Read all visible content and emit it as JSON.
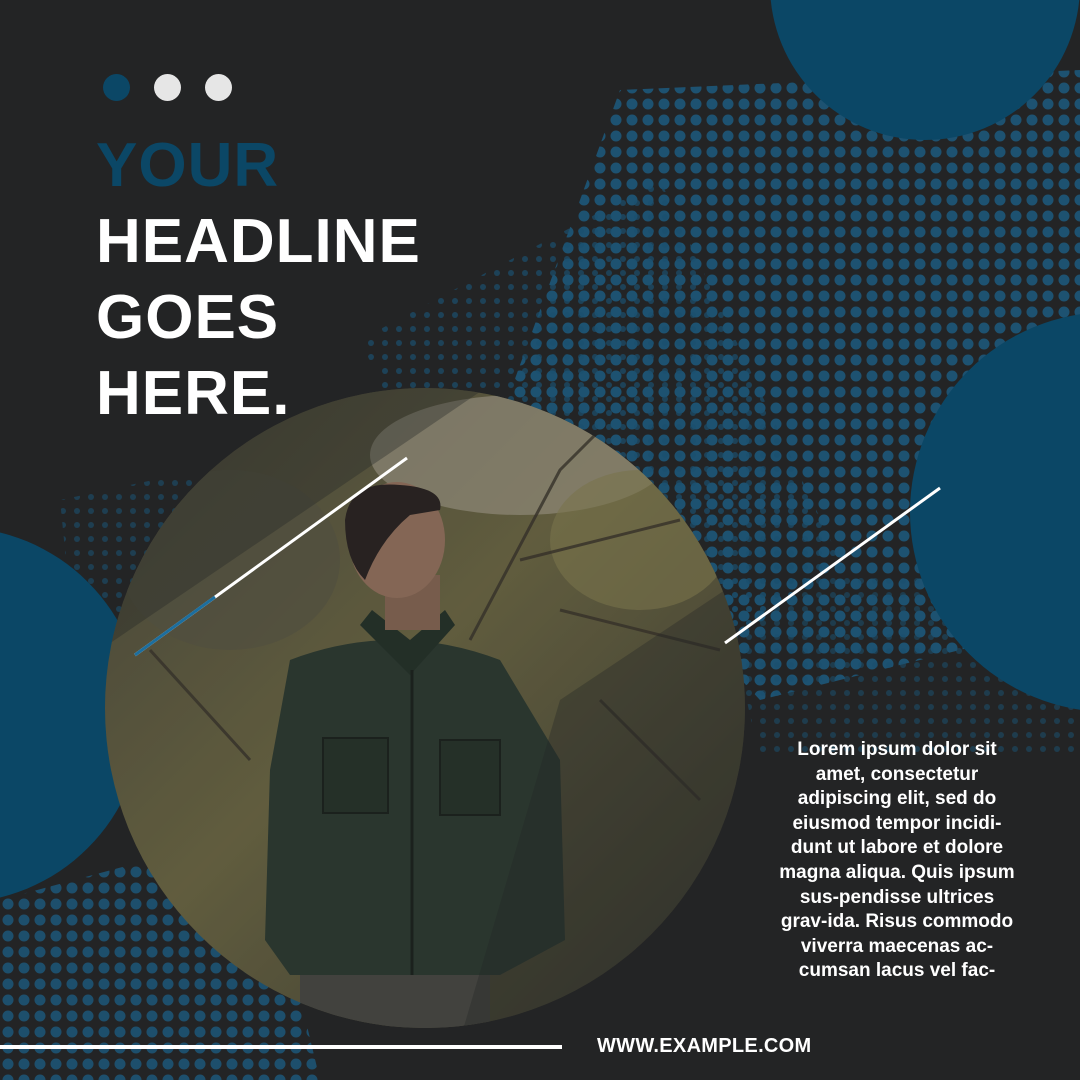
{
  "headline": {
    "line1": "YOUR",
    "line2": "HEADLINE",
    "line3": "GOES",
    "line4": "HERE."
  },
  "body_text": "Lorem ipsum dolor sit amet, consectetur adipiscing elit, sed do eiusmod tempor incidi-dunt ut labore et dolore magna aliqua. Quis ipsum sus-pendisse ultrices grav-ida. Risus commodo viverra maecenas ac-cumsan lacus vel fac-",
  "website": "WWW.EXAMPLE.COM",
  "colors": {
    "background": "#232425",
    "accent": "#0b4766",
    "text": "#ffffff",
    "dot_inactive": "#e6e6e6"
  },
  "icons": [
    "pagination-dots"
  ]
}
